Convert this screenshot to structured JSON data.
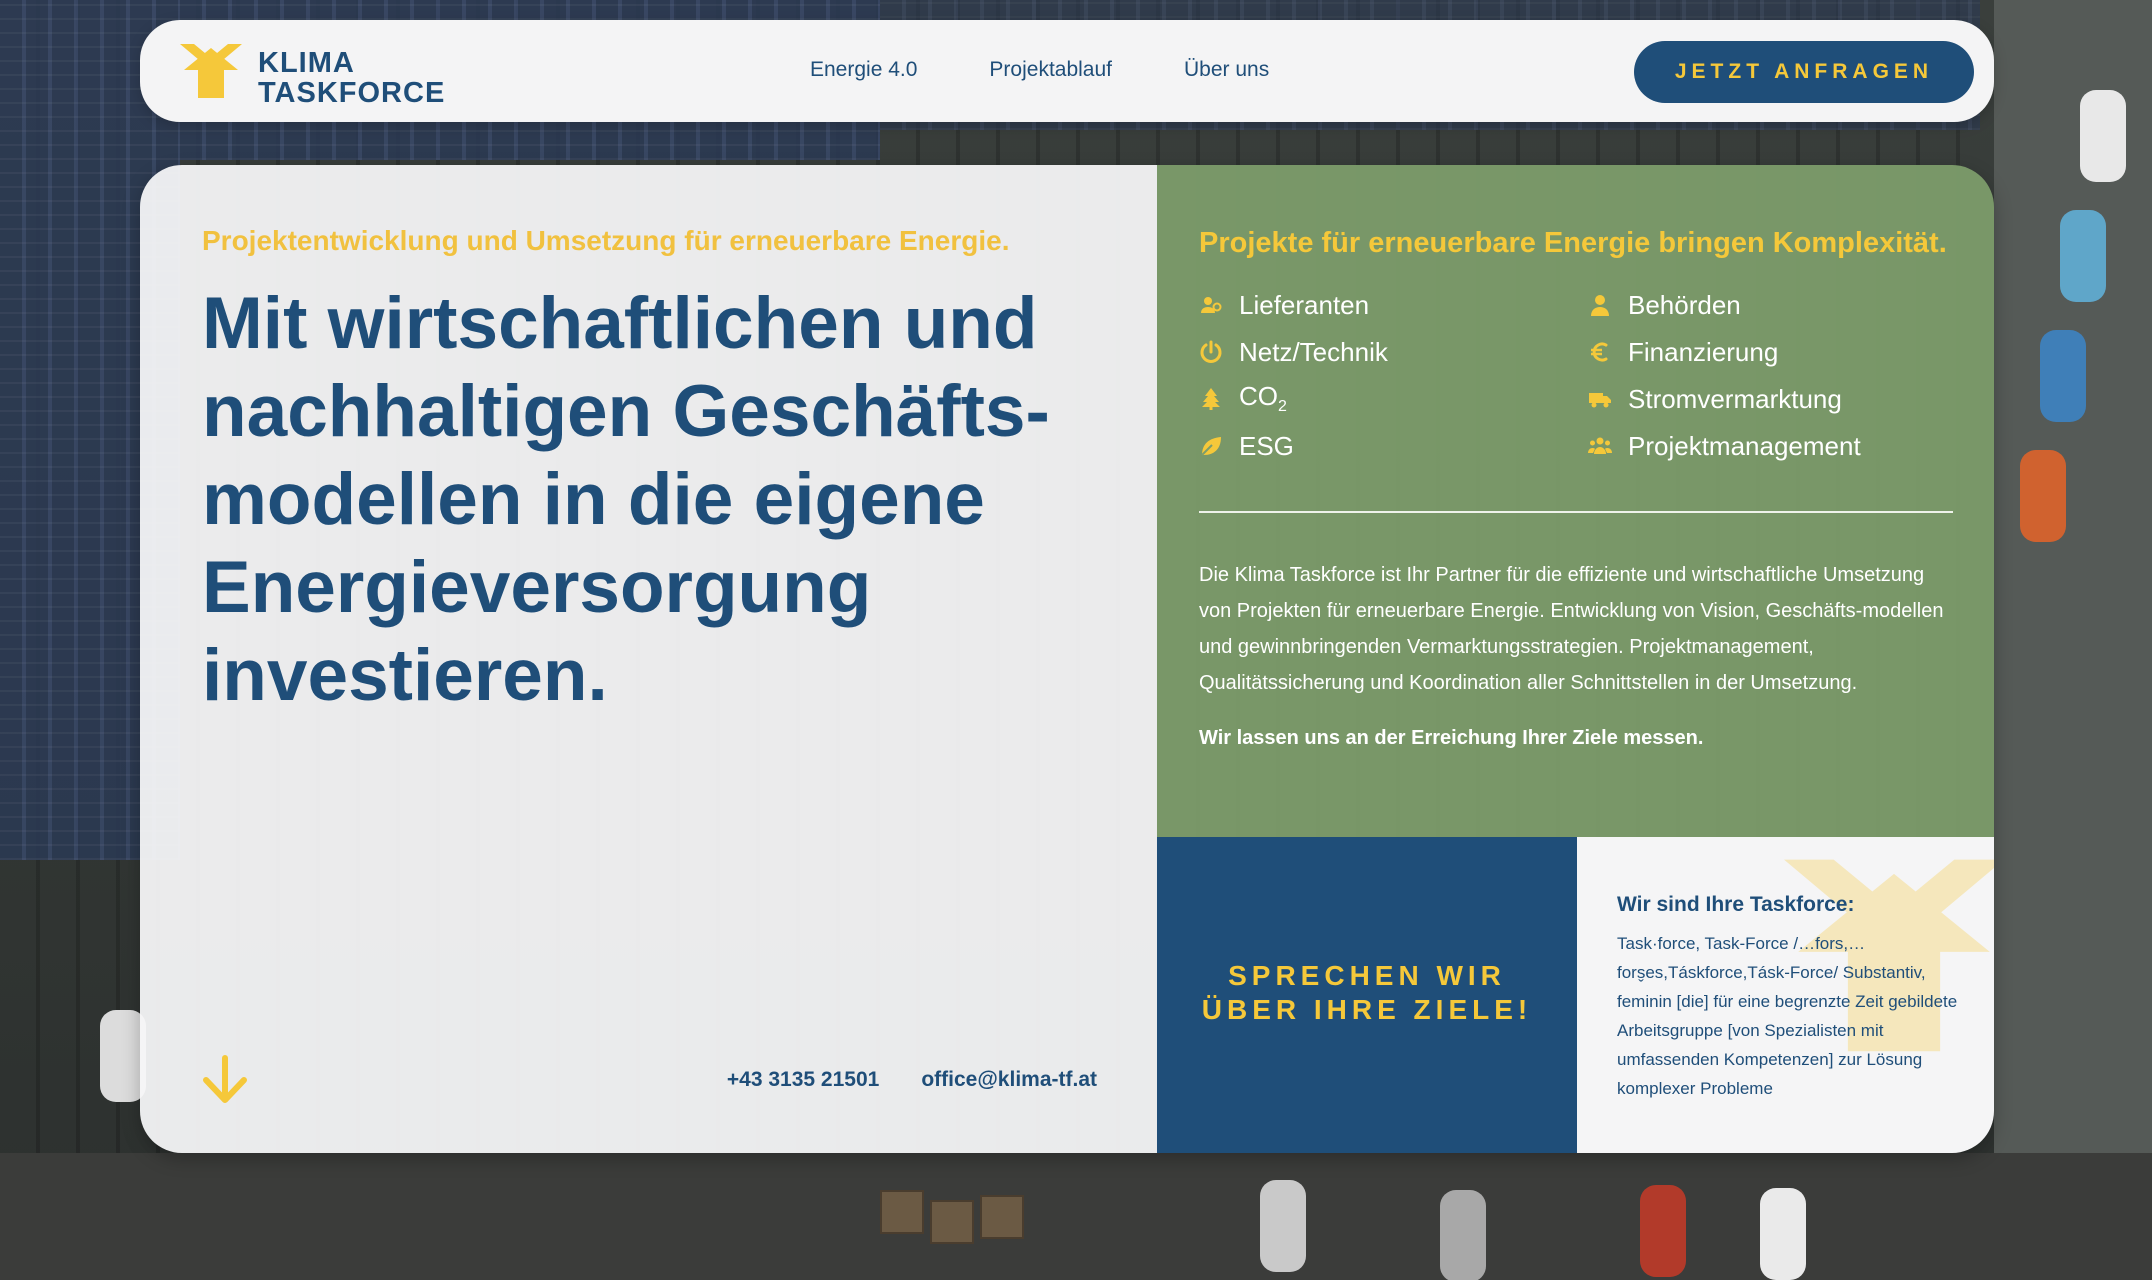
{
  "brand": {
    "name_line1": "KLIMA",
    "name_line2": "TASKFORCE",
    "logo_icon": "arrow-up-logo-icon",
    "colors": {
      "navy": "#1f4e79",
      "yellow": "#f5c83a",
      "green": "#7d9d6b",
      "white": "#f5f5f6"
    }
  },
  "nav": {
    "links": [
      "Energie 4.0",
      "Projektablauf",
      "Über uns"
    ],
    "cta_label": "JETZT ANFRAGEN"
  },
  "hero": {
    "eyebrow": "Projektentwicklung und Umsetzung für erneuerbare Energie.",
    "headline": "Mit wirtschaftlichen und nachhaltigen Geschäfts-modellen in die eigene Energieversorgung investieren.",
    "scroll_icon": "arrow-down-icon",
    "phone": "+43 3135 21501",
    "email": "office@klima-tf.at"
  },
  "complexity": {
    "title": "Projekte für erneuerbare Energie bringen Komplexität.",
    "items": [
      {
        "label": "Lieferanten",
        "icon": "suppliers-icon"
      },
      {
        "label": "Behörden",
        "icon": "authority-icon"
      },
      {
        "label": "Netz/Technik",
        "icon": "power-icon"
      },
      {
        "label": "Finanzierung",
        "icon": "euro-icon"
      },
      {
        "label": "CO",
        "sub": "2",
        "icon": "tree-icon"
      },
      {
        "label": "Stromvermarktung",
        "icon": "truck-icon"
      },
      {
        "label": "ESG",
        "icon": "leaf-icon"
      },
      {
        "label": "Projektmanagement",
        "icon": "team-icon"
      }
    ],
    "description": "Die Klima Taskforce ist Ihr Partner für die effiziente und wirtschaftliche Umsetzung von Projekten für erneuerbare Energie. Entwicklung von Vision, Geschäfts-modellen und gewinnbringenden Vermarktungsstrategien. Projektmanagement, Qualitätssicherung und Koordination aller Schnittstellen in der Umsetzung.",
    "claim": "Wir lassen uns an der Erreichung Ihrer Ziele messen."
  },
  "talk": {
    "line1": "SPRECHEN WIR",
    "line2": "ÜBER IHRE ZIELE!"
  },
  "definition": {
    "title": "Wir sind Ihre Taskforce:",
    "body": "Task·force, Task-Force /…fors,… fors̬es,Táskforce,Tásk-Force/ Substantiv, feminin [die] für eine begrenzte Zeit gebildete Arbeitsgruppe [von Spezialisten mit umfassenden Kompetenzen] zur Lösung komplexer Probleme"
  }
}
